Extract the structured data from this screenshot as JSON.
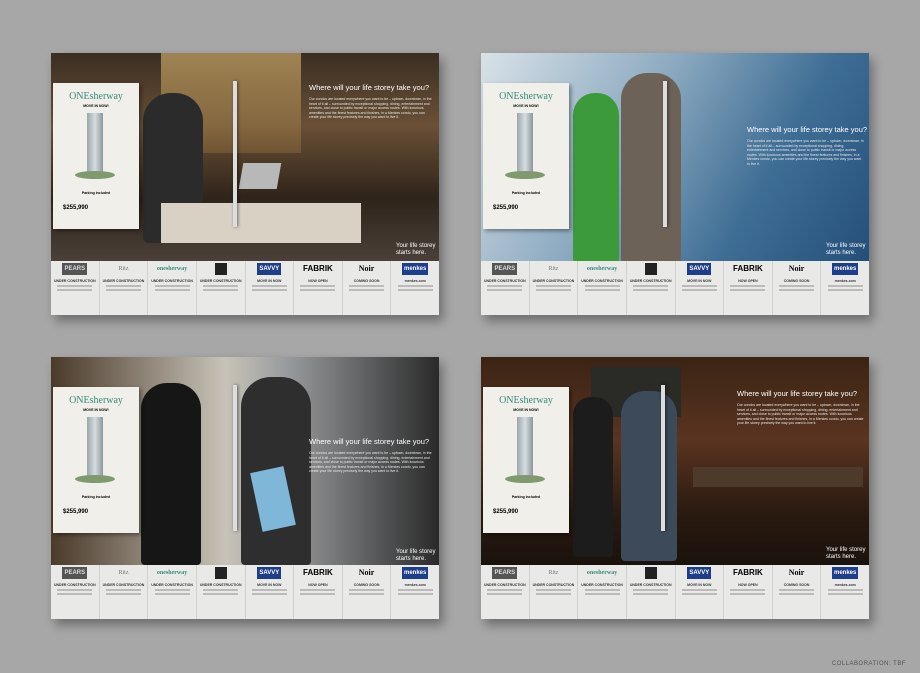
{
  "ad": {
    "headline": "Where will your life storey take you?",
    "subhead": "Menkes builds condos that reflect who you are.",
    "body": "Our condos are located everywhere you want to be – uptown, downtown, in the heart of it all – surrounded by exceptional shopping, dining, entertainment and services, and close to public transit or major access routes. With luxurious amenities and the finest features and finishes, in a Menkes condo, you can create your life storey precisely the way you want to live it.",
    "tagline": "Your life storey starts here.",
    "card": {
      "brand": "ONEsherway",
      "status": "MOVE IN NOW!",
      "parking": "Parking included",
      "address": "225 Sherway Gardens Rd., Etobicoke",
      "price": "$255,990"
    },
    "strip": [
      {
        "logo": "PEARS",
        "status": "UNDER CONSTRUCTION"
      },
      {
        "logo": "Ritz",
        "status": "UNDER CONSTRUCTION"
      },
      {
        "logo": "onesherway",
        "status": "UNDER CONSTRUCTION"
      },
      {
        "logo": "",
        "status": "UNDER CONSTRUCTION"
      },
      {
        "logo": "SAVVY",
        "status": "MOVE IN NOW"
      },
      {
        "logo": "FABRIK",
        "status": "NOW OPEN"
      },
      {
        "logo": "Noir",
        "status": "COMING SOON"
      },
      {
        "logo": "menkes",
        "status": "menkes.com"
      }
    ]
  },
  "credit": "COLLABORATION: TBF",
  "colors": {
    "brand_teal": "#3a8a7f",
    "menkes_blue": "#1e3d8a",
    "background": "#a7a7a7"
  }
}
